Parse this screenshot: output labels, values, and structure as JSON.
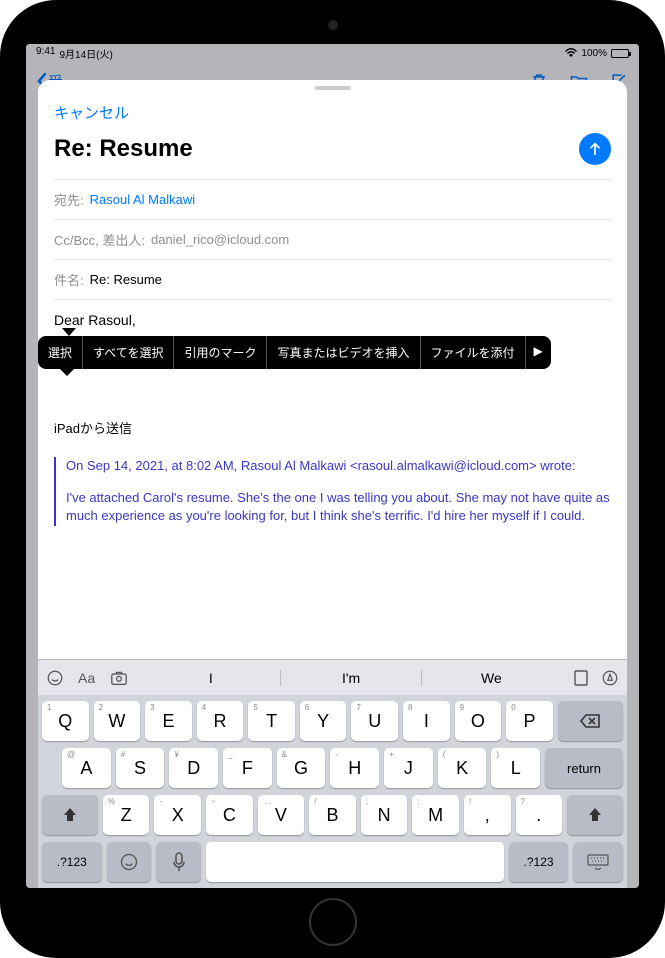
{
  "status": {
    "time": "9:41",
    "date": "9月14日(火)",
    "battery": "100%"
  },
  "bg_nav": {
    "back": "受"
  },
  "compose": {
    "cancel": "キャンセル",
    "subject": "Re: Resume",
    "to_label": "宛先:",
    "to_value": "Rasoul Al Malkawi",
    "cc_label": "Cc/Bcc, 差出人:",
    "cc_value": "daniel_rico@icloud.com",
    "subject_label": "件名:",
    "subject_value": "Re: Resume",
    "body_greeting": "Dear Rasoul,",
    "signature": "iPadから送信",
    "quoted_header": "On Sep 14, 2021, at 8:02 AM, Rasoul Al Malkawi <rasoul.almalkawi@icloud.com> wrote:",
    "quoted_body": "I've attached Carol's resume. She's the one I was telling you about. She may not have quite as much experience as you're looking for, but I think she's terrific. I'd hire her myself if I could."
  },
  "context_menu": {
    "items": [
      "選択",
      "すべてを選択",
      "引用のマーク",
      "写真またはビデオを挿入",
      "ファイルを添付"
    ],
    "more": "▶"
  },
  "keyboard": {
    "suggestions": [
      "I",
      "I'm",
      "We"
    ],
    "row1": [
      {
        "hint": "1",
        "k": "Q"
      },
      {
        "hint": "2",
        "k": "W"
      },
      {
        "hint": "3",
        "k": "E"
      },
      {
        "hint": "4",
        "k": "R"
      },
      {
        "hint": "5",
        "k": "T"
      },
      {
        "hint": "6",
        "k": "Y"
      },
      {
        "hint": "7",
        "k": "U"
      },
      {
        "hint": "8",
        "k": "I"
      },
      {
        "hint": "9",
        "k": "O"
      },
      {
        "hint": "0",
        "k": "P"
      }
    ],
    "row2": [
      {
        "hint": "@",
        "k": "A"
      },
      {
        "hint": "#",
        "k": "S"
      },
      {
        "hint": "¥",
        "k": "D"
      },
      {
        "hint": "_",
        "k": "F"
      },
      {
        "hint": "&",
        "k": "G"
      },
      {
        "hint": "-",
        "k": "H"
      },
      {
        "hint": "+",
        "k": "J"
      },
      {
        "hint": "(",
        "k": "K"
      },
      {
        "hint": ")",
        "k": "L"
      }
    ],
    "row3": [
      {
        "hint": "%",
        "k": "Z"
      },
      {
        "hint": "-",
        "k": "X"
      },
      {
        "hint": "~",
        "k": "C"
      },
      {
        "hint": "…",
        "k": "V"
      },
      {
        "hint": "/",
        "k": "B"
      },
      {
        "hint": ";",
        "k": "N"
      },
      {
        "hint": ":",
        "k": "M"
      },
      {
        "hint": "!",
        "k": ","
      },
      {
        "hint": "?",
        "k": "."
      }
    ],
    "return": "return",
    "numkey": ".?123"
  }
}
